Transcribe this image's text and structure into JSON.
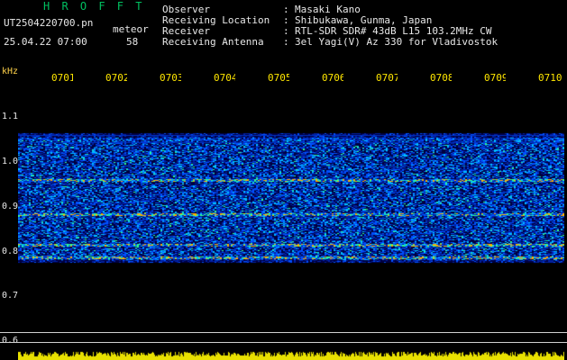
{
  "header": {
    "title": "H R O F F T",
    "filename": "UT2504220700.pn",
    "meteor_label": "meteor",
    "datetime": "25.04.22 07:00",
    "count": "58"
  },
  "info": [
    {
      "label": "Observer",
      "value": "Masaki Kano"
    },
    {
      "label": "Receiving Location",
      "value": "Shibukawa, Gunma, Japan"
    },
    {
      "label": "Receiver",
      "value": "RTL-SDR SDR# 43dB L15 103.2MHz CW"
    },
    {
      "label": "Receiving Antenna",
      "value": "3el Yagi(V) Az 330 for Vladivostok"
    }
  ],
  "colon": ":",
  "axis": {
    "unit": "kHz",
    "x_ticks": [
      "0701",
      "0702",
      "0703",
      "0704",
      "0705",
      "0706",
      "0707",
      "0708",
      "0709",
      "0710"
    ],
    "y_ticks": [
      "1.1",
      "1.0",
      "0.9",
      "0.8",
      "0.7",
      "0.6"
    ]
  },
  "colors": {
    "background": "#000000",
    "tick_yellow": "#ffe600",
    "title_green": "#00c060",
    "text": "#e8e8e8"
  }
}
